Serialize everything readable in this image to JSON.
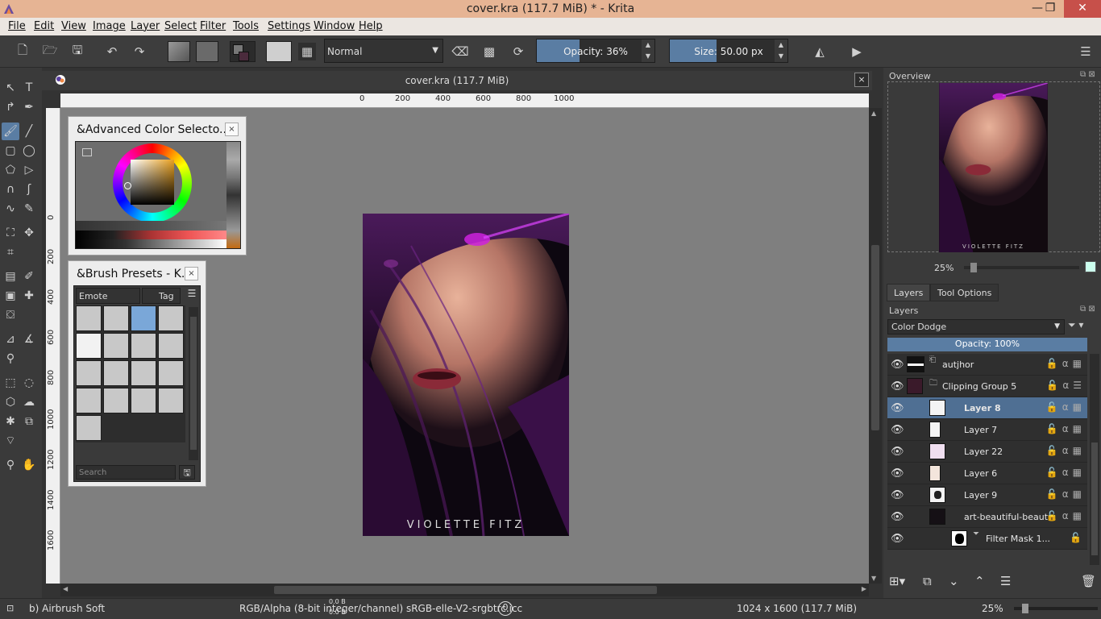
{
  "window": {
    "title": "cover.kra (117.7 MiB) * - Krita",
    "minimize": "—",
    "maximize": "❐",
    "close": "✕"
  },
  "menu": [
    "File",
    "Edit",
    "View",
    "Image",
    "Layer",
    "Select",
    "Filter",
    "Tools",
    "Settings",
    "Window",
    "Help"
  ],
  "toolbar": {
    "blend_mode": "Normal",
    "opacity_label": "Opacity:  36%",
    "opacity_value": 36,
    "size_label": "Size:  50.00 px",
    "accent": "#5a7da3"
  },
  "document": {
    "tab_title": "cover.kra (117.7 MiB)",
    "close": "×",
    "hruler": [
      "0",
      "200",
      "400",
      "600",
      "800",
      "1000"
    ],
    "vruler": [
      "0",
      "200",
      "400",
      "600",
      "800",
      "1000",
      "1200",
      "1400",
      "1600"
    ],
    "cover_caption": "VIOLETTE FITZ"
  },
  "color_selector": {
    "title": "&Advanced Color Selecto...",
    "close": "×"
  },
  "brush_presets": {
    "title": "&Brush Presets - K...",
    "close": "×",
    "tag_filter": "Emote",
    "tag_button": "Tag",
    "search_placeholder": "Search"
  },
  "overview": {
    "title": "Overview",
    "zoom": "25%",
    "caption": "VIOLETTE FITZ"
  },
  "tabs": {
    "layers": "Layers",
    "tool_options": "Tool Options"
  },
  "layers": {
    "title": "Layers",
    "blend_mode": "Color Dodge",
    "opacity": "Opacity:  100%",
    "items": [
      {
        "name": "autjhor",
        "bold": false
      },
      {
        "name": "Clipping Group 5",
        "bold": false
      },
      {
        "name": "Layer 8",
        "bold": true
      },
      {
        "name": "Layer 7",
        "bold": false
      },
      {
        "name": "Layer 22",
        "bold": false
      },
      {
        "name": "Layer 6",
        "bold": false
      },
      {
        "name": "Layer 9",
        "bold": false
      },
      {
        "name": "art-beautiful-beaut...",
        "bold": false
      },
      {
        "name": "Filter Mask 1...",
        "bold": false
      }
    ]
  },
  "status": {
    "brush": "b) Airbrush Soft",
    "colorspace": "RGB/Alpha (8-bit integer/channel)  sRGB-elle-V2-srgbtrc.icc",
    "bytes_a": "0.0 B",
    "bytes_b": "0.0 B",
    "counter": "0",
    "image_size": "1024 x 1600 (117.7 MiB)",
    "zoom": "25%"
  }
}
